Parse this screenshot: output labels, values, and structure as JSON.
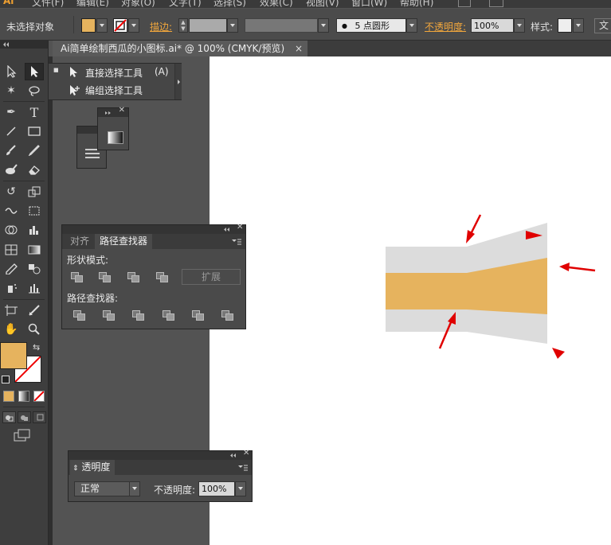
{
  "menubar": {
    "logo": "Ai",
    "items": [
      "文件(F)",
      "编辑(E)",
      "对象(O)",
      "文字(T)",
      "选择(S)",
      "效果(C)",
      "视图(V)",
      "窗口(W)",
      "帮助(H)"
    ]
  },
  "control_bar": {
    "selection_status": "未选择对象",
    "fill_color": "#E6B35E",
    "stroke_label": "描边:",
    "brush_label": "5 点圆形",
    "opacity_label": "不透明度:",
    "opacity_value": "100%",
    "style_label": "样式:",
    "doc_button": "文"
  },
  "document_tab": {
    "title": "Ai简单绘制西瓜的小图标.ai* @ 100% (CMYK/预览)",
    "close": "×"
  },
  "tool_flyout": {
    "items": [
      {
        "label": "直接选择工具",
        "shortcut": "(A)",
        "bullet": "■"
      },
      {
        "label": "编组选择工具",
        "shortcut": ""
      }
    ]
  },
  "pathfinder_panel": {
    "tabs": [
      "对齐",
      "路径查找器"
    ],
    "shape_modes_label": "形状模式:",
    "expand_button": "扩展",
    "pathfinders_label": "路径查找器:"
  },
  "transparency_panel": {
    "title": "透明度",
    "blend_mode": "正常",
    "opacity_label": "不透明度:",
    "opacity_value": "100%"
  },
  "colors": {
    "accent_orange": "#E6B35E",
    "shape_gray": "#DCDCDC",
    "arrow_red": "#E00000",
    "canvas": "#FFFFFF"
  }
}
